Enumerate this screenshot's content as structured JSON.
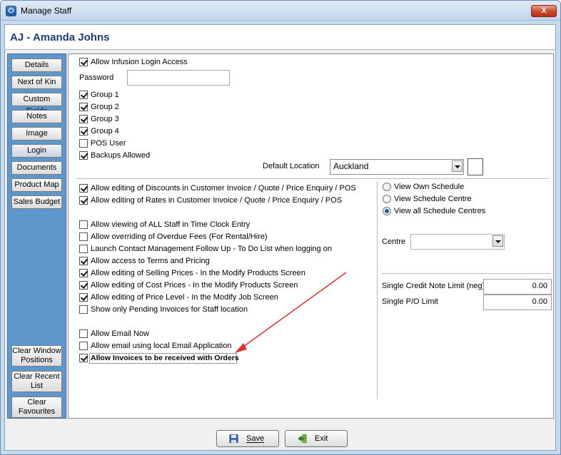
{
  "window": {
    "title": "Manage Staff",
    "close_label": "X",
    "icon": "power-icon"
  },
  "staff": {
    "name": "AJ - Amanda Johns"
  },
  "nav": {
    "items": [
      {
        "label": "Details"
      },
      {
        "label": "Next of Kin"
      },
      {
        "label": "Custom Fields"
      },
      {
        "label": "Notes"
      },
      {
        "label": "Image"
      },
      {
        "label": "Login"
      },
      {
        "label": "Documents"
      },
      {
        "label": "Product Map"
      },
      {
        "label": "Sales Budget"
      }
    ],
    "bottom": [
      {
        "line1": "Clear Window",
        "line2": "Positions"
      },
      {
        "line1": "Clear Recent",
        "line2": "List"
      },
      {
        "line1": "Clear",
        "line2": "Favourites"
      }
    ]
  },
  "login": {
    "allow_login": {
      "label": "Allow Infusion Login Access",
      "checked": true
    },
    "password_label": "Password",
    "password_value": "",
    "groups": [
      {
        "label": "Group 1",
        "checked": true
      },
      {
        "label": "Group 2",
        "checked": true
      },
      {
        "label": "Group 3",
        "checked": true
      },
      {
        "label": "Group 4",
        "checked": true
      },
      {
        "label": "POS User",
        "checked": false
      },
      {
        "label": "Backups Allowed",
        "checked": true
      }
    ],
    "default_location_label": "Default Location",
    "default_location_value": "Auckland"
  },
  "permissions": {
    "block1": [
      {
        "label": "Allow editing of Discounts in Customer Invoice / Quote / Price Enquiry / POS",
        "checked": true
      },
      {
        "label": "Allow editing of Rates in Customer Invoice / Quote / Price Enquiry / POS",
        "checked": true
      }
    ],
    "block2": [
      {
        "label": "Allow viewing of ALL Staff in Time Clock Entry",
        "checked": false
      },
      {
        "label": "Allow overriding of Overdue Fees (For Rental/Hire)",
        "checked": false
      },
      {
        "label": "Launch Contact Management Follow Up - To Do List when logging on",
        "checked": false
      },
      {
        "label": "Allow access to Terms and Pricing",
        "checked": true
      },
      {
        "label": "Allow editing of Selling Prices - In the Modify Products Screen",
        "checked": true
      },
      {
        "label": "Allow editing of Cost Prices - In the Modify Products Screen",
        "checked": true
      },
      {
        "label": "Allow editing of Price Level - In the Modify Job Screen",
        "checked": true
      },
      {
        "label": "Show only Pending Invoices for Staff location",
        "checked": false
      }
    ],
    "block3": [
      {
        "label": "Allow Email Now",
        "checked": false
      },
      {
        "label": "Allow email using local Email Application",
        "checked": false
      },
      {
        "label": "Allow Invoices to be received with Orders",
        "checked": true,
        "focused": true
      }
    ]
  },
  "schedule": {
    "options": [
      {
        "label": "View Own Schedule",
        "selected": false
      },
      {
        "label": "View Schedule Centre",
        "selected": false
      },
      {
        "label": "View all Schedule Centres",
        "selected": true
      }
    ],
    "centre_label": "Centre",
    "centre_value": ""
  },
  "limits": {
    "credit_note_label": "Single Credit Note Limit (neg)",
    "credit_note_value": "0.00",
    "po_label": "Single P/O Limit",
    "po_value": "0.00"
  },
  "footer": {
    "save_label": "Save",
    "exit_label": "Exit"
  },
  "colors": {
    "accent_arrow": "#e03030",
    "nav_panel": "#5d97cb",
    "name_text": "#1b3f7a"
  }
}
